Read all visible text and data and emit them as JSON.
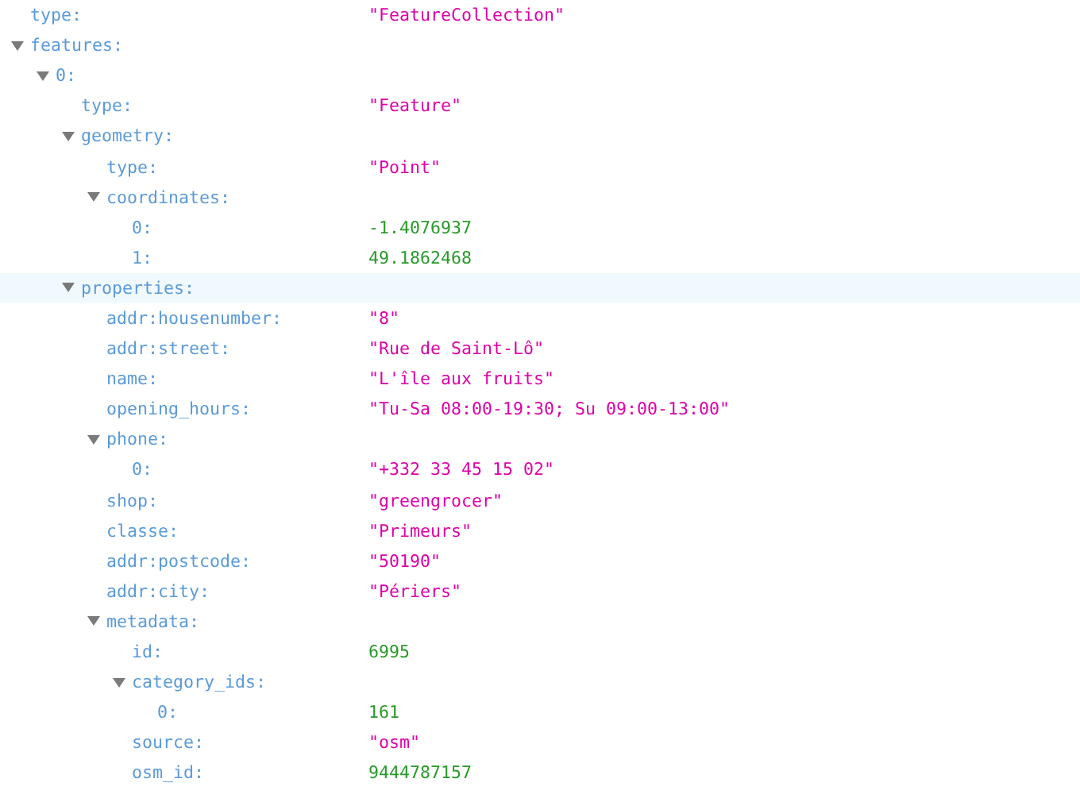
{
  "tree": [
    {
      "key": "type:",
      "value": "\"FeatureCollection\"",
      "kind": "string",
      "selected": false
    },
    {
      "key": "features:",
      "expanded": true,
      "selected": false,
      "children": [
        {
          "key": "0:",
          "expanded": true,
          "selected": false,
          "children": [
            {
              "key": "type:",
              "value": "\"Feature\"",
              "kind": "string",
              "selected": false
            },
            {
              "key": "geometry:",
              "expanded": true,
              "selected": false,
              "children": [
                {
                  "key": "type:",
                  "value": "\"Point\"",
                  "kind": "string",
                  "selected": false
                },
                {
                  "key": "coordinates:",
                  "expanded": true,
                  "selected": false,
                  "children": [
                    {
                      "key": "0:",
                      "value": "-1.4076937",
                      "kind": "number",
                      "selected": false
                    },
                    {
                      "key": "1:",
                      "value": "49.1862468",
                      "kind": "number",
                      "selected": false
                    }
                  ]
                }
              ]
            },
            {
              "key": "properties:",
              "expanded": true,
              "selected": true,
              "children": [
                {
                  "key": "addr:housenumber:",
                  "value": "\"8\"",
                  "kind": "string",
                  "selected": false
                },
                {
                  "key": "addr:street:",
                  "value": "\"Rue de Saint-Lô\"",
                  "kind": "string",
                  "selected": false
                },
                {
                  "key": "name:",
                  "value": "\"L'île aux fruits\"",
                  "kind": "string",
                  "selected": false
                },
                {
                  "key": "opening_hours:",
                  "value": "\"Tu-Sa 08:00-19:30; Su 09:00-13:00\"",
                  "kind": "string",
                  "selected": false
                },
                {
                  "key": "phone:",
                  "expanded": true,
                  "selected": false,
                  "children": [
                    {
                      "key": "0:",
                      "value": "\"+332 33 45 15 02\"",
                      "kind": "string",
                      "selected": false
                    }
                  ]
                },
                {
                  "key": "shop:",
                  "value": "\"greengrocer\"",
                  "kind": "string",
                  "selected": false
                },
                {
                  "key": "classe:",
                  "value": "\"Primeurs\"",
                  "kind": "string",
                  "selected": false
                },
                {
                  "key": "addr:postcode:",
                  "value": "\"50190\"",
                  "kind": "string",
                  "selected": false
                },
                {
                  "key": "addr:city:",
                  "value": "\"Périers\"",
                  "kind": "string",
                  "selected": false
                },
                {
                  "key": "metadata:",
                  "expanded": true,
                  "selected": false,
                  "children": [
                    {
                      "key": "id:",
                      "value": "6995",
                      "kind": "number",
                      "selected": false
                    },
                    {
                      "key": "category_ids:",
                      "expanded": true,
                      "selected": false,
                      "children": [
                        {
                          "key": "0:",
                          "value": "161",
                          "kind": "number",
                          "selected": false
                        }
                      ]
                    },
                    {
                      "key": "source:",
                      "value": "\"osm\"",
                      "kind": "string",
                      "selected": false
                    },
                    {
                      "key": "osm_id:",
                      "value": "9444787157",
                      "kind": "number",
                      "selected": false
                    }
                  ]
                }
              ]
            }
          ]
        }
      ]
    }
  ]
}
